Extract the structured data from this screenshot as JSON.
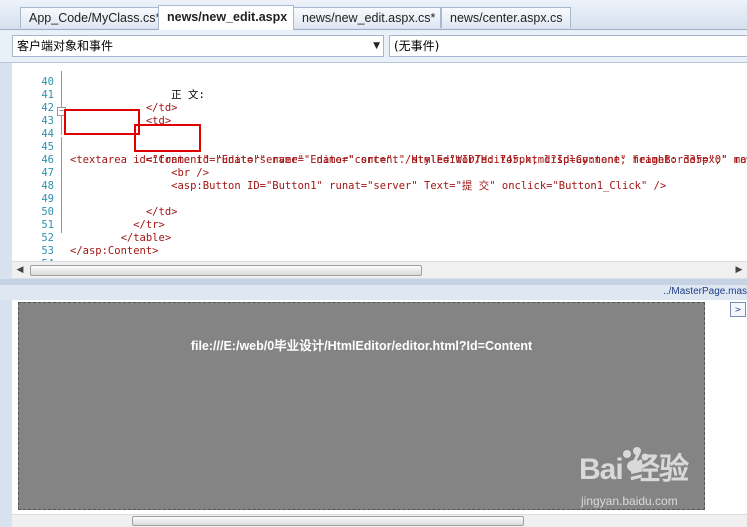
{
  "tabs": [
    {
      "label": "App_Code/MyClass.cs*",
      "active": false
    },
    {
      "label": "news/new_edit.aspx",
      "active": true
    },
    {
      "label": "news/new_edit.aspx.cs*",
      "active": false
    },
    {
      "label": "news/center.aspx.cs",
      "active": false
    }
  ],
  "toolbar": {
    "object_combo": "客户端对象和事件",
    "event_combo": "(无事件)"
  },
  "editor": {
    "lines": [
      {
        "num": "40",
        "text": "                正 文:"
      },
      {
        "num": "41",
        "text": "            </td>"
      },
      {
        "num": "42",
        "text": "            <td>"
      },
      {
        "num": "43",
        "text": ""
      },
      {
        "num": "44",
        "text": "<textarea id=\"Content\" runat=\"server\"  name=\"content\" style=\"WIDTH: 745px; display:none; height: 335px;\" rows=\"3"
      },
      {
        "num": "45",
        "text": "            <iframe id=\"Editor\" name=\"Editor\" src=\"../HtmlEditor/editor.html?Id=Content\" frameBorder=\"0\" marginHei"
      },
      {
        "num": "46",
        "text": "                <br />"
      },
      {
        "num": "47",
        "text": "                <asp:Button ID=\"Button1\" runat=\"server\" Text=\"提 交\" onclick=\"Button1_Click\" />"
      },
      {
        "num": "48",
        "text": ""
      },
      {
        "num": "49",
        "text": "            </td>"
      },
      {
        "num": "50",
        "text": "          </tr>"
      },
      {
        "num": "51",
        "text": "        </table>"
      },
      {
        "num": "52",
        "text": "</asp:Content>"
      },
      {
        "num": "53",
        "text": ""
      },
      {
        "num": "54",
        "text": ""
      }
    ]
  },
  "breadcrumb": "../MasterPage.mas",
  "design": {
    "iframe_path": "file:///E:/web/0毕业设计/HtmlEditor/editor.html?Id=Content"
  },
  "watermark": {
    "brand": "Bai 经验",
    "url": "jingyan.baidu.com"
  },
  "icons": [
    "dropdown-arrow-icon",
    "fold-toggle-icon",
    "scroll-left-icon",
    "scroll-right-icon",
    "expand-icon",
    "baidu-paw-icon"
  ]
}
